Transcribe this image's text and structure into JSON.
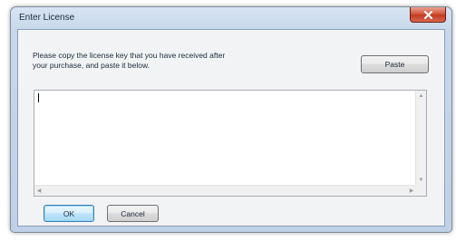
{
  "window": {
    "title": "Enter License",
    "close_icon": "close-icon"
  },
  "dialog": {
    "message_line1": "Please copy the license key that you have received after",
    "message_line2": "your purchase, and paste it below.",
    "paste_label": "Paste",
    "license_value": "",
    "ok_label": "OK",
    "cancel_label": "Cancel"
  },
  "icons": {
    "scroll_up": "▲",
    "scroll_down": "▼",
    "scroll_left": "◀",
    "scroll_right": "▶"
  },
  "colors": {
    "close_button": "#c94a32",
    "default_button_border": "#3c7fb1",
    "window_frame": "#c5d7ea"
  }
}
